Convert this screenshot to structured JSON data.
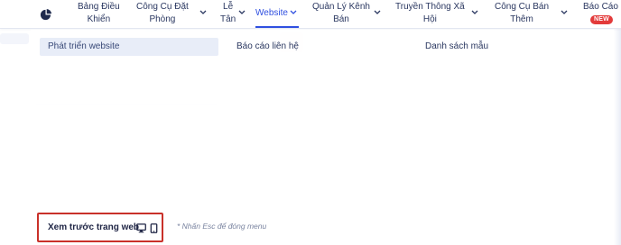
{
  "navbar": {
    "logo_icon": "pie-chart-icon",
    "accent_color": "#2f4fe0",
    "items": [
      {
        "lines": [
          "Bảng Điều",
          "Khiển"
        ],
        "has_chevron": false
      },
      {
        "lines": [
          "Công Cụ Đặt",
          "Phòng"
        ],
        "has_chevron": true
      },
      {
        "lines": [
          "Lễ",
          "Tân"
        ],
        "has_chevron": true
      },
      {
        "lines": [
          "Website"
        ],
        "has_chevron": true,
        "active": true
      },
      {
        "lines": [
          "Quản Lý Kênh",
          "Bán"
        ],
        "has_chevron": true
      },
      {
        "lines": [
          "Truyền Thông Xã",
          "Hội"
        ],
        "has_chevron": true
      },
      {
        "lines": [
          "Công Cụ Bán",
          "Thêm"
        ],
        "has_chevron": true
      },
      {
        "lines": [
          "Báo Cáo"
        ],
        "has_chevron": false,
        "badge": "NEW"
      }
    ]
  },
  "dropdown": {
    "options": [
      {
        "label": "Phát triển website",
        "selected": true
      },
      {
        "label": "Báo cáo liên hệ",
        "selected": false
      },
      {
        "label": "Danh sách mẫu",
        "selected": false
      }
    ],
    "preview_button": {
      "label": "Xem trước trang web",
      "icons": [
        "desktop-icon",
        "tablet-icon"
      ],
      "border_color": "#c9312a"
    },
    "hint": "* Nhấn Esc để đóng menu"
  }
}
